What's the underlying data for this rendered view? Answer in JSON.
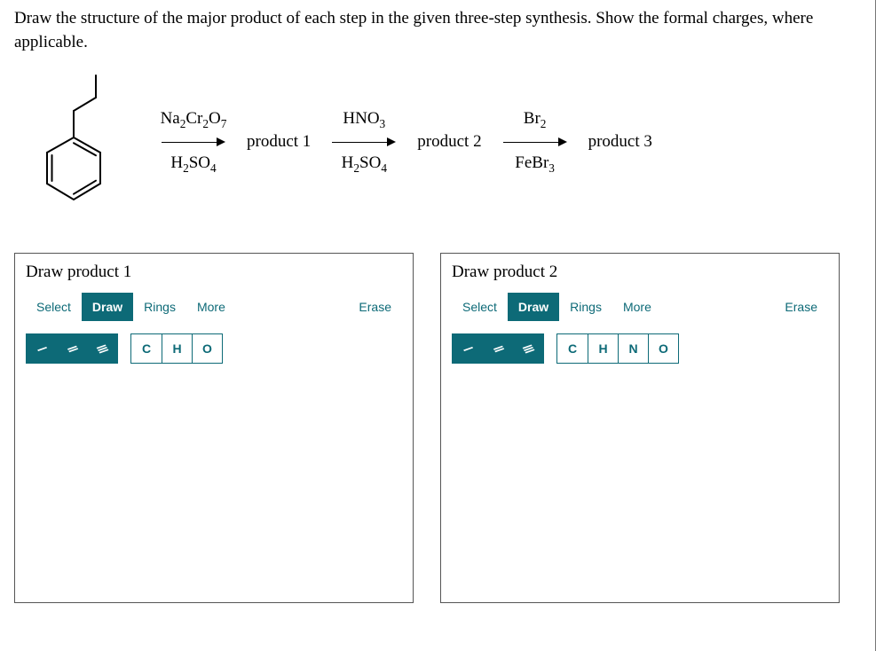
{
  "question": "Draw the structure of the major product of each step in the given three-step synthesis. Show the formal charges, where applicable.",
  "reaction": {
    "step1": {
      "top": "Na₂Cr₂O₇",
      "bottom": "H₂SO₄",
      "product": "product 1"
    },
    "step2": {
      "top": "HNO₃",
      "bottom": "H₂SO₄",
      "product": "product 2"
    },
    "step3": {
      "top": "Br₂",
      "bottom": "FeBr₃",
      "product": "product 3"
    }
  },
  "panel1": {
    "title": "Draw product 1",
    "tabs": {
      "select": "Select",
      "draw": "Draw",
      "rings": "Rings",
      "more": "More"
    },
    "erase": "Erase",
    "bonds": {
      "single": "/",
      "double": "//",
      "triple": "///"
    },
    "atoms": [
      "C",
      "H",
      "O"
    ]
  },
  "panel2": {
    "title": "Draw product 2",
    "tabs": {
      "select": "Select",
      "draw": "Draw",
      "rings": "Rings",
      "more": "More"
    },
    "erase": "Erase",
    "bonds": {
      "single": "/",
      "double": "//",
      "triple": "///"
    },
    "atoms": [
      "C",
      "H",
      "N",
      "O"
    ]
  }
}
